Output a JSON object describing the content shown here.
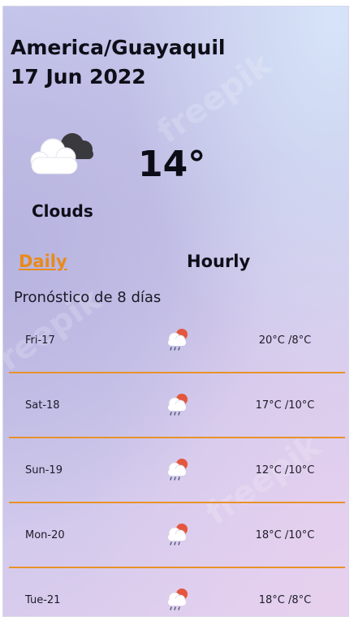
{
  "header": {
    "location": "America/Guayaquil",
    "date": "17 Jun 2022"
  },
  "current": {
    "icon": "clouds-icon",
    "temperature": "14°",
    "condition": "Clouds"
  },
  "tabs": {
    "daily_label": "Daily",
    "hourly_label": "Hourly",
    "active": "Daily"
  },
  "forecast": {
    "title": "Pronóstico de 8 días",
    "days": [
      {
        "day": "Fri-17",
        "icon": "rain-cloud-icon",
        "range": "20°C /8°C"
      },
      {
        "day": "Sat-18",
        "icon": "rain-cloud-icon",
        "range": "17°C /10°C"
      },
      {
        "day": "Sun-19",
        "icon": "rain-cloud-icon",
        "range": "12°C /10°C"
      },
      {
        "day": "Mon-20",
        "icon": "rain-cloud-icon",
        "range": "18°C /10°C"
      },
      {
        "day": "Tue-21",
        "icon": "rain-cloud-icon",
        "range": "18°C /8°C"
      }
    ]
  },
  "colors": {
    "accent": "#e88a1a",
    "divider": "#e8922a",
    "text": "#0e0e18"
  }
}
